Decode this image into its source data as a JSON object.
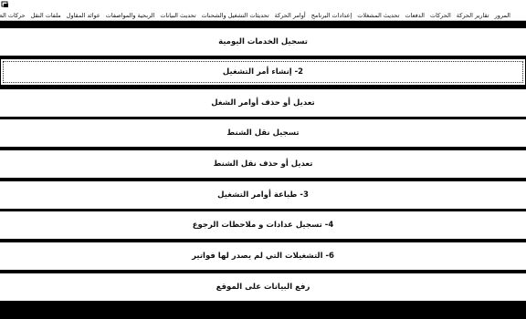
{
  "window": {
    "icon": "app-icon"
  },
  "menu": [
    "المرور",
    "تقارير الحركة",
    "الحركات",
    "الدفعات",
    "تحديث المشغلات",
    "إعدادات البرنامج",
    "أوامر الحركة",
    "تحديثات التشغيل والشحنات",
    "تحديث البيانات",
    "الربحية والمواصفات",
    "عوائد المقاول",
    "ملفات النقل",
    "حركات الطرق",
    "المصادقات"
  ],
  "buttons": [
    {
      "label": "تسجيل الخدمات اليومية",
      "focused": false
    },
    {
      "label": "2- إنشاء أمر التشغيل",
      "focused": true
    },
    {
      "label": "تعديل أو حذف أوامر الشغل",
      "focused": false
    },
    {
      "label": "تسجيل نقل الشنط",
      "focused": false
    },
    {
      "label": "تعديل أو حذف نقل الشنط",
      "focused": false
    },
    {
      "label": "3- طباعة أوامر التشغيل",
      "focused": false
    },
    {
      "label": "4- تسجيل عدادات و ملاحظات الرجوع",
      "focused": false
    },
    {
      "label": "6- التشغيلات التي لم يصدر لها فواتير",
      "focused": false
    },
    {
      "label": "رفع البيانات على الموقع",
      "focused": false
    }
  ]
}
